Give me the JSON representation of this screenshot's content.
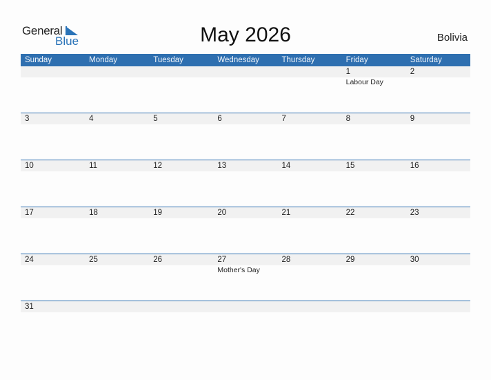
{
  "logo": {
    "word1": "General",
    "word2": "Blue"
  },
  "header": {
    "title": "May 2026",
    "country": "Bolivia"
  },
  "colors": {
    "accent": "#2e6fb0",
    "strip": "#f1f1f1"
  },
  "days": [
    "Sunday",
    "Monday",
    "Tuesday",
    "Wednesday",
    "Thursday",
    "Friday",
    "Saturday"
  ],
  "weeks": [
    {
      "dates": [
        "",
        "",
        "",
        "",
        "",
        "1",
        "2"
      ],
      "events": [
        "",
        "",
        "",
        "",
        "",
        "Labour Day",
        ""
      ]
    },
    {
      "dates": [
        "3",
        "4",
        "5",
        "6",
        "7",
        "8",
        "9"
      ],
      "events": [
        "",
        "",
        "",
        "",
        "",
        "",
        ""
      ]
    },
    {
      "dates": [
        "10",
        "11",
        "12",
        "13",
        "14",
        "15",
        "16"
      ],
      "events": [
        "",
        "",
        "",
        "",
        "",
        "",
        ""
      ]
    },
    {
      "dates": [
        "17",
        "18",
        "19",
        "20",
        "21",
        "22",
        "23"
      ],
      "events": [
        "",
        "",
        "",
        "",
        "",
        "",
        ""
      ]
    },
    {
      "dates": [
        "24",
        "25",
        "26",
        "27",
        "28",
        "29",
        "30"
      ],
      "events": [
        "",
        "",
        "",
        "Mother's Day",
        "",
        "",
        ""
      ]
    },
    {
      "dates": [
        "31",
        "",
        "",
        "",
        "",
        "",
        ""
      ],
      "events": [
        "",
        "",
        "",
        "",
        "",
        "",
        ""
      ]
    }
  ]
}
